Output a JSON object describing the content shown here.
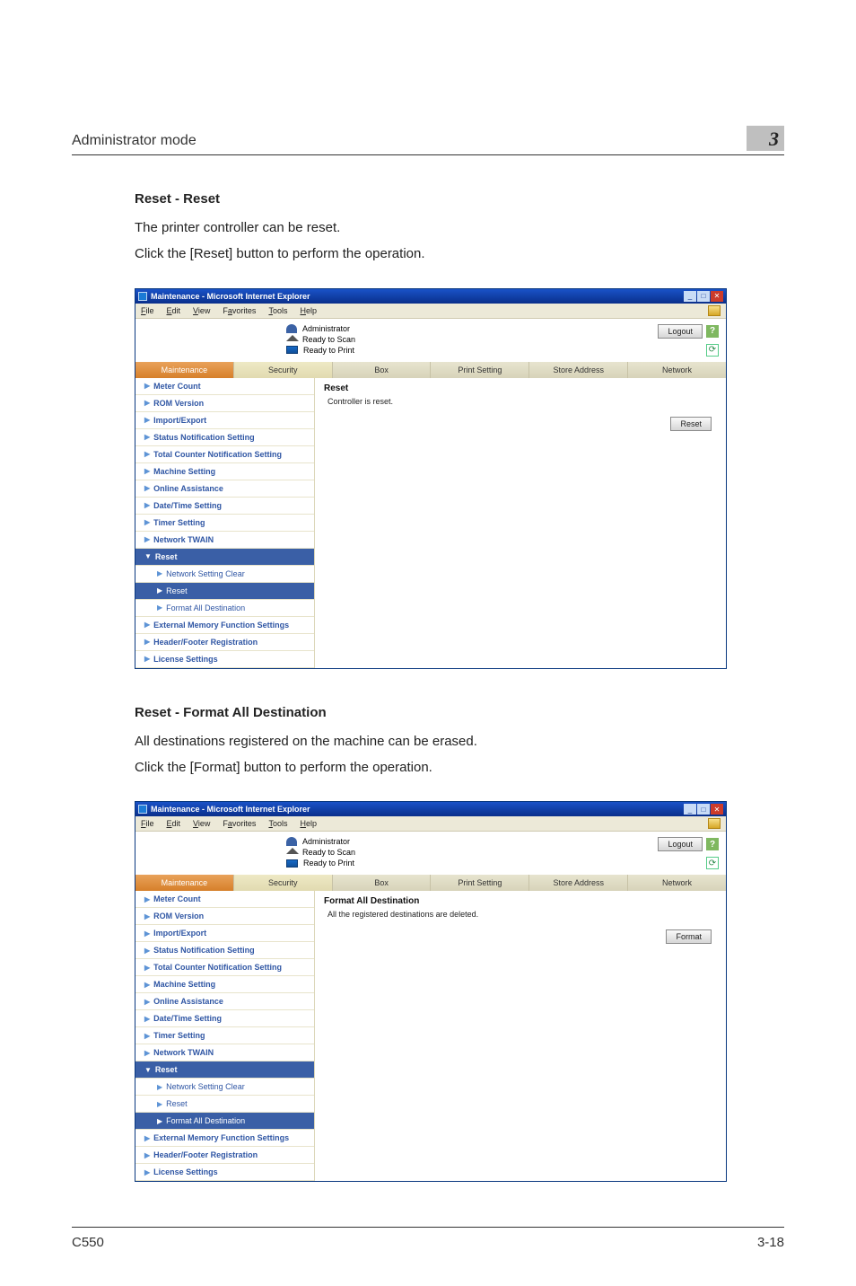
{
  "header": {
    "section_title": "Administrator mode",
    "chapter_number": "3"
  },
  "sections": [
    {
      "title": "Reset - Reset",
      "lines": [
        "The printer controller can be reset.",
        "Click the [Reset] button to perform the operation."
      ],
      "shot": {
        "ie_title": "Maintenance - Microsoft Internet Explorer",
        "menubar": [
          "File",
          "Edit",
          "View",
          "Favorites",
          "Tools",
          "Help"
        ],
        "admin_label": "Administrator",
        "status_scan": "Ready to Scan",
        "status_print": "Ready to Print",
        "logout": "Logout",
        "tabs": [
          "Maintenance",
          "Security",
          "Box",
          "Print Setting",
          "Store Address",
          "Network"
        ],
        "active_tab_index": 0,
        "nav": [
          {
            "l": "Meter Count",
            "sub": false
          },
          {
            "l": "ROM Version",
            "sub": false
          },
          {
            "l": "Import/Export",
            "sub": false
          },
          {
            "l": "Status Notification Setting",
            "sub": false
          },
          {
            "l": "Total Counter Notification Setting",
            "sub": false
          },
          {
            "l": "Machine Setting",
            "sub": false
          },
          {
            "l": "Online Assistance",
            "sub": false
          },
          {
            "l": "Date/Time Setting",
            "sub": false
          },
          {
            "l": "Timer Setting",
            "sub": false
          },
          {
            "l": "Network TWAIN",
            "sub": false
          },
          {
            "l": "Reset",
            "grouphead": true
          },
          {
            "l": "Network Setting Clear",
            "sub": true
          },
          {
            "l": "Reset",
            "sub": true,
            "sel": true
          },
          {
            "l": "Format All Destination",
            "sub": true
          },
          {
            "l": "External Memory Function Settings",
            "sub": false
          },
          {
            "l": "Header/Footer Registration",
            "sub": false
          },
          {
            "l": "License Settings",
            "sub": false
          }
        ],
        "pane_title": "Reset",
        "pane_msg": "Controller is reset.",
        "pane_button": "Reset"
      }
    },
    {
      "title": "Reset - Format All Destination",
      "lines": [
        "All destinations registered on the machine can be erased.",
        "Click the [Format] button to perform the operation."
      ],
      "shot": {
        "ie_title": "Maintenance - Microsoft Internet Explorer",
        "menubar": [
          "File",
          "Edit",
          "View",
          "Favorites",
          "Tools",
          "Help"
        ],
        "admin_label": "Administrator",
        "status_scan": "Ready to Scan",
        "status_print": "Ready to Print",
        "logout": "Logout",
        "tabs": [
          "Maintenance",
          "Security",
          "Box",
          "Print Setting",
          "Store Address",
          "Network"
        ],
        "active_tab_index": 0,
        "nav": [
          {
            "l": "Meter Count",
            "sub": false
          },
          {
            "l": "ROM Version",
            "sub": false
          },
          {
            "l": "Import/Export",
            "sub": false
          },
          {
            "l": "Status Notification Setting",
            "sub": false
          },
          {
            "l": "Total Counter Notification Setting",
            "sub": false
          },
          {
            "l": "Machine Setting",
            "sub": false
          },
          {
            "l": "Online Assistance",
            "sub": false
          },
          {
            "l": "Date/Time Setting",
            "sub": false
          },
          {
            "l": "Timer Setting",
            "sub": false
          },
          {
            "l": "Network TWAIN",
            "sub": false
          },
          {
            "l": "Reset",
            "grouphead": true
          },
          {
            "l": "Network Setting Clear",
            "sub": true
          },
          {
            "l": "Reset",
            "sub": true
          },
          {
            "l": "Format All Destination",
            "sub": true,
            "sel": true
          },
          {
            "l": "External Memory Function Settings",
            "sub": false
          },
          {
            "l": "Header/Footer Registration",
            "sub": false
          },
          {
            "l": "License Settings",
            "sub": false
          }
        ],
        "pane_title": "Format All Destination",
        "pane_msg": "All the registered destinations are deleted.",
        "pane_button": "Format"
      }
    }
  ],
  "footer": {
    "left": "C550",
    "right": "3-18"
  }
}
